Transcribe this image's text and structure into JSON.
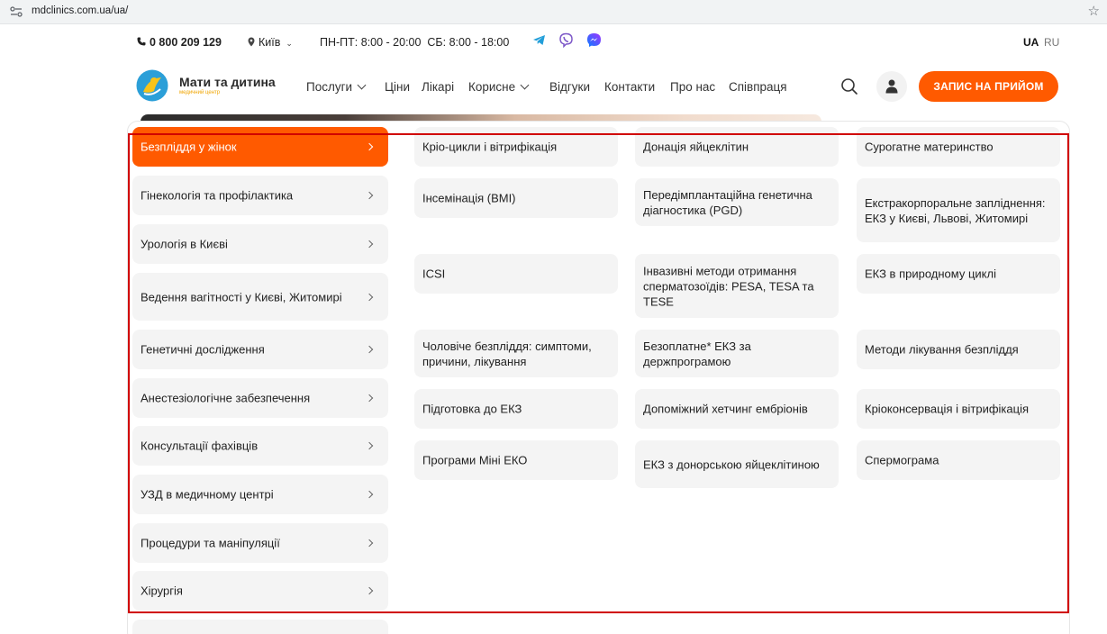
{
  "browser": {
    "url": "mdclinics.com.ua/ua/"
  },
  "topbar": {
    "phone": "0 800 209 129",
    "city": "Київ",
    "hours": "ПН-ПТ: 8:00 - 20:00  СБ: 8:00 - 18:00",
    "messengers": [
      "telegram-icon",
      "viber-icon",
      "messenger-icon"
    ],
    "languages": [
      "UA",
      "RU"
    ],
    "active_language": "UA"
  },
  "header": {
    "logo_name": "Мати та дитина",
    "logo_sub": "медичний центр",
    "nav": [
      "Послуги",
      "Ціни",
      "Лікарі",
      "Корисне",
      "Відгуки",
      "Контакти",
      "Про нас",
      "Співпраця"
    ],
    "cta": "ЗАПИС НА ПРИЙОМ"
  },
  "categories": [
    "Безпліддя у жінок",
    "Гінекологія та профілактика",
    "Урологія в Києві",
    "Ведення вагітності у Києві, Житомирі",
    "Генетичні дослідження",
    "Анестезіологічне забезпечення",
    "Консультації фахівців",
    "УЗД в медичному центрі",
    "Процедури та маніпуляції",
    "Хірургія"
  ],
  "active_category": "Безпліддя у жінок",
  "subitems": [
    "Кріо-цикли і вітрифікація",
    "Донація яйцеклітин",
    "Сурогатне материнство",
    "Інсемінація (ВМІ)",
    "Передімплантаційна генетична діагностика (PGD)",
    "Екстракорпоральне запліднення: ЕКЗ у Києві, Львові, Житомирі",
    "ICSI",
    "Інвазивні методи отримання сперматозоїдів: PESA, TESA та TESE",
    "ЕКЗ в природному циклі",
    "Чоловіче безпліддя: симптоми, причини, лікування",
    "Безоплатне* ЕКЗ за держпрограмою",
    "Методи лікування безпліддя",
    "Підготовка до ЕКЗ",
    "Допоміжний хетчинг ембріонів",
    "Кріоконсервація і вітрифікація",
    "Програми Міні ЕКО",
    "ЕКЗ з донорською яйцеклітиною",
    "Спермограма"
  ],
  "colors": {
    "accent": "#ff5a00",
    "highlight_box": "#d00000"
  }
}
